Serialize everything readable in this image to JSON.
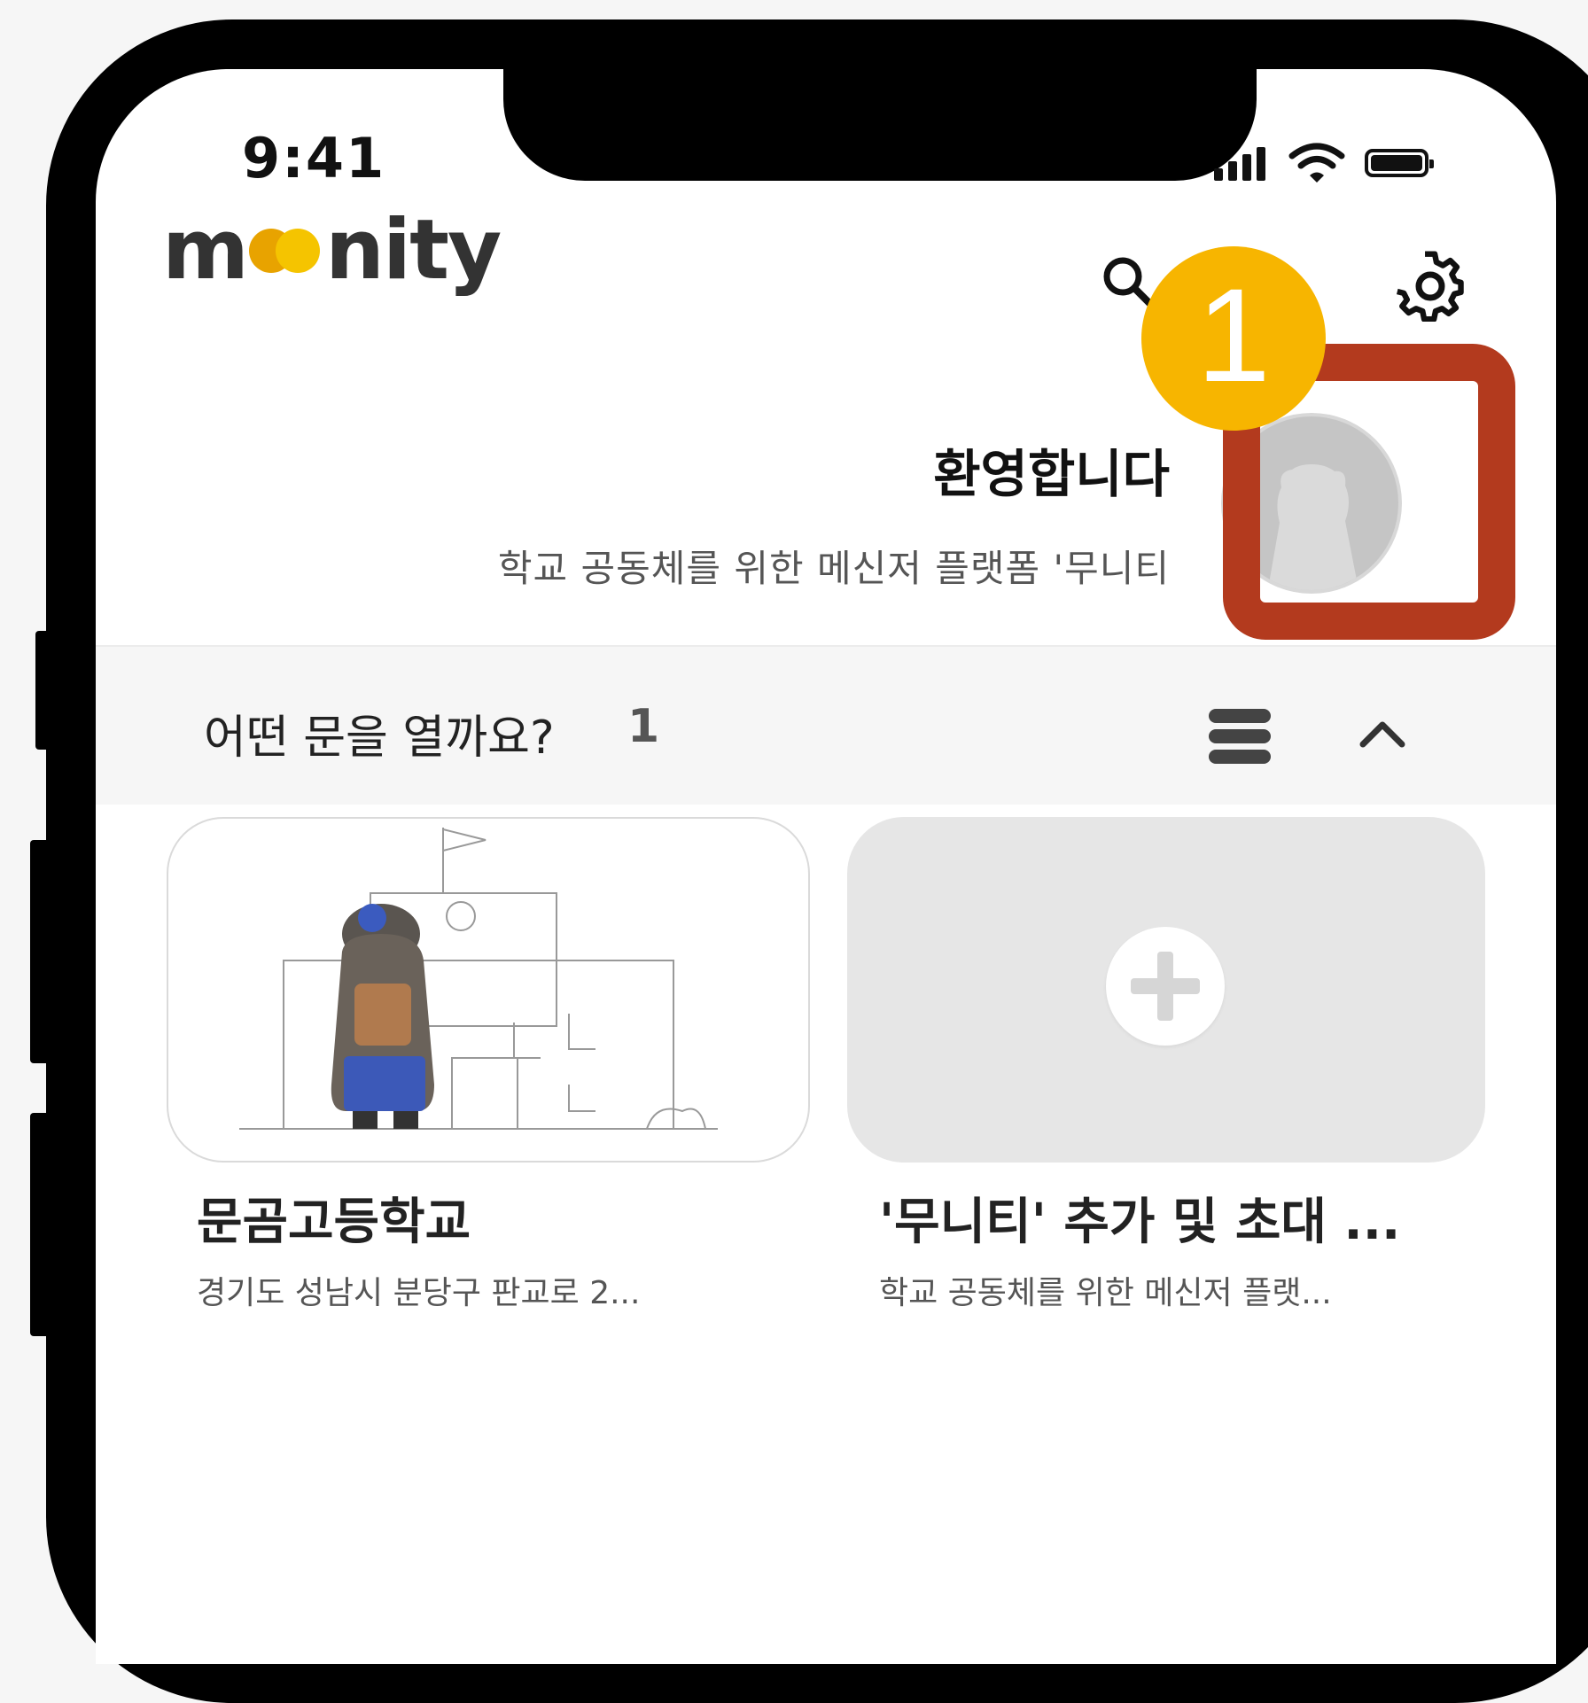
{
  "status_bar": {
    "time": "9:41"
  },
  "app": {
    "logo": {
      "prefix": "m",
      "suffix": "nity",
      "colors": {
        "first_o": "#e8a300",
        "second_o": "#f5c400"
      }
    },
    "icons": {
      "search": "search-icon",
      "scan": "qr-scan-icon",
      "settings": "gear-icon"
    }
  },
  "welcome": {
    "title": "환영합니다",
    "subtitle": "학교 공동체를 위한 메신저 플랫폼 '무니티"
  },
  "section": {
    "label": "어떤 문을 열까요?",
    "count": "1"
  },
  "cards": [
    {
      "title": "문곰고등학교",
      "subtitle": "경기도 성남시 분당구 판교로 2..."
    },
    {
      "title": "'무니티' 추가 및 초대 ...",
      "subtitle": "학교 공동체를 위한 메신저 플랫..."
    }
  ],
  "annotation": {
    "step": "1",
    "box_color": "#b33a1e",
    "badge_color": "#f7b500"
  }
}
